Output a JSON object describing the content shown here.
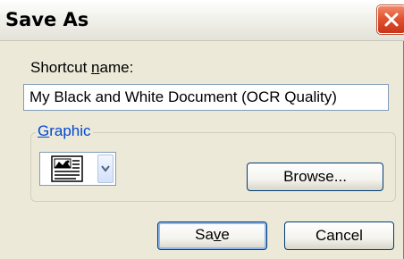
{
  "window": {
    "title": "Save As"
  },
  "form": {
    "shortcut_label_prefix": "Shortcut ",
    "shortcut_label_mnemonic": "n",
    "shortcut_label_suffix": "ame:",
    "shortcut_name_value": "My Black and White Document (OCR Quality)"
  },
  "graphic_group": {
    "legend_mnemonic": "G",
    "legend_rest": "raphic",
    "icon_name": "document-image-icon",
    "browse_label": "Browse..."
  },
  "buttons": {
    "save_prefix": "Sa",
    "save_mnemonic": "v",
    "save_suffix": "e",
    "cancel_label": "Cancel"
  },
  "colors": {
    "group_legend": "#0046d5",
    "close_button": "#e2542f",
    "dialog_background": "#ece9d8"
  }
}
